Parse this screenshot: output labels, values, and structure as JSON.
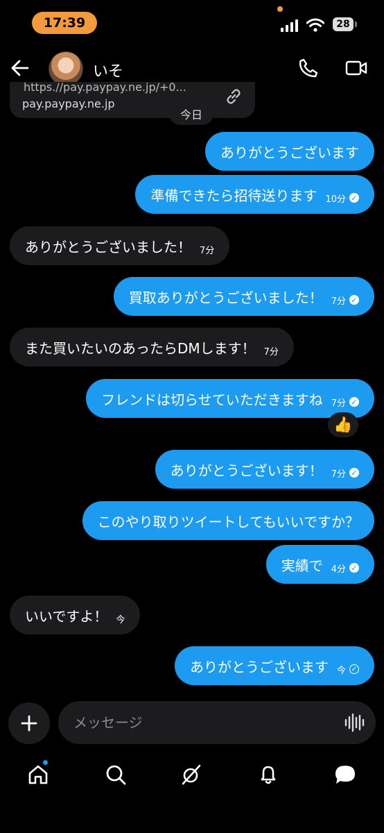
{
  "status_bar": {
    "time": "17:39",
    "battery": "28"
  },
  "header": {
    "contact_name": "いそ"
  },
  "link_preview": {
    "url_partial": "https.//pay.paypay.ne.jp/+0...",
    "domain": "pay.paypay.ne.jp"
  },
  "date_separator": "今日",
  "messages": [
    {
      "text": "ありがとうございます",
      "time": "",
      "direction": "out"
    },
    {
      "text": "準備できたら招待送ります",
      "time": "10分",
      "direction": "out"
    },
    {
      "text": "ありがとうございました！",
      "time": "7分",
      "direction": "in"
    },
    {
      "text": "買取ありがとうございました！",
      "time": "7分",
      "direction": "out"
    },
    {
      "text": "また買いたいのあったらDMします！",
      "time": "7分",
      "direction": "in"
    },
    {
      "text": "フレンドは切らせていただきますね",
      "time": "7分",
      "direction": "out"
    },
    {
      "text": "ありがとうございます！",
      "time": "7分",
      "direction": "out"
    },
    {
      "text": "このやり取りツイートしてもいいですか？",
      "time": "",
      "direction": "out"
    },
    {
      "text": "実績で",
      "time": "4分",
      "direction": "out"
    },
    {
      "text": "いいですよ！",
      "time": "今",
      "direction": "in"
    },
    {
      "text": "ありがとうございます",
      "time": "今",
      "direction": "out"
    }
  ],
  "reaction": {
    "emoji": "👍"
  },
  "composer": {
    "placeholder": "メッセージ"
  },
  "colors": {
    "accent": "#1d9bf0",
    "incoming_bubble": "#1c1c1e",
    "status_pill": "#f39a3d",
    "background": "#000000"
  },
  "icons": [
    "back-arrow-icon",
    "phone-icon",
    "video-icon",
    "link-icon",
    "plus-icon",
    "voice-wave-icon",
    "home-icon",
    "search-icon",
    "grok-icon",
    "bell-icon",
    "messages-icon"
  ]
}
